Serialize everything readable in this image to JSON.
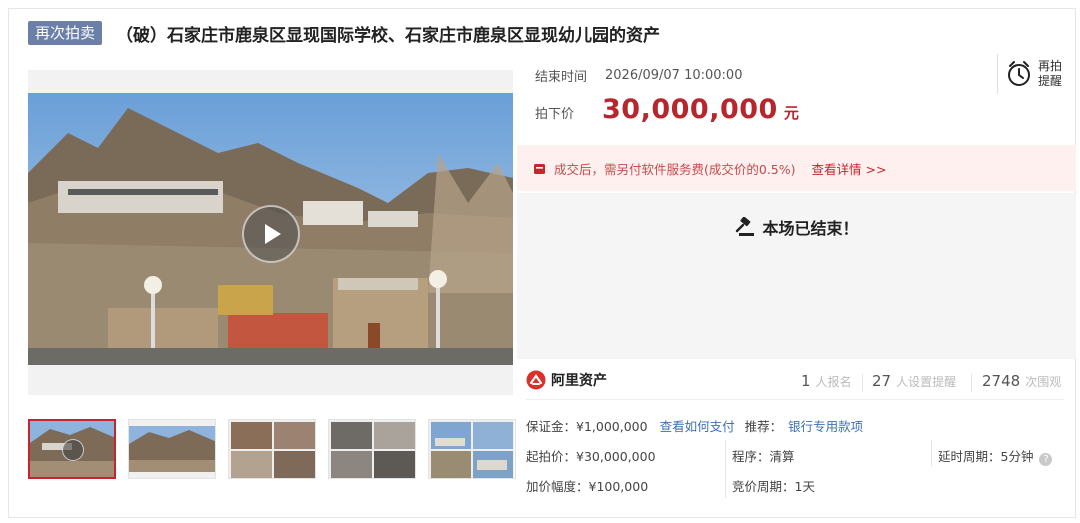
{
  "header": {
    "badge": "再次拍卖",
    "title": "（破）石家庄市鹿泉区显现国际学校、石家庄市鹿泉区显现幼儿园的资产"
  },
  "auction": {
    "end_time_label": "结束时间",
    "end_time": "2026/09/07 10:00:00",
    "price_label": "拍下价",
    "price": "30,000,000",
    "price_unit": "元",
    "remind_label": "再拍提醒",
    "notice_text": "成交后，需另付软件服务费(成交价的0.5%)",
    "notice_link": "查看详情 >>",
    "ended_text": "本场已结束！"
  },
  "stats": {
    "brand": "阿里资产",
    "signup_count": "1",
    "signup_label": "人报名",
    "remind_count": "27",
    "remind_label": "人设置提醒",
    "view_count": "2748",
    "view_label": "次围观"
  },
  "details": {
    "deposit": "保证金：¥1,000,000",
    "pay_link": "查看如何支付",
    "recommend_label": "推荐：",
    "recommend_link": "银行专用款项",
    "start_price": "起拍价：¥30,000,000",
    "procedure": "程序：清算",
    "delay": "延时周期：5分钟",
    "increment": "加价幅度：¥100,000",
    "bid_period": "竞价周期：1天"
  },
  "colors": {
    "accent": "#b8262d",
    "badge": "#6b7fa8",
    "link": "#3d6fb5",
    "notice_bg": "#fdf0ef"
  },
  "icons": [
    "play-icon",
    "alarm-clock-icon",
    "wallet-icon",
    "gavel-icon",
    "ali-assets-logo-icon",
    "help-icon"
  ]
}
